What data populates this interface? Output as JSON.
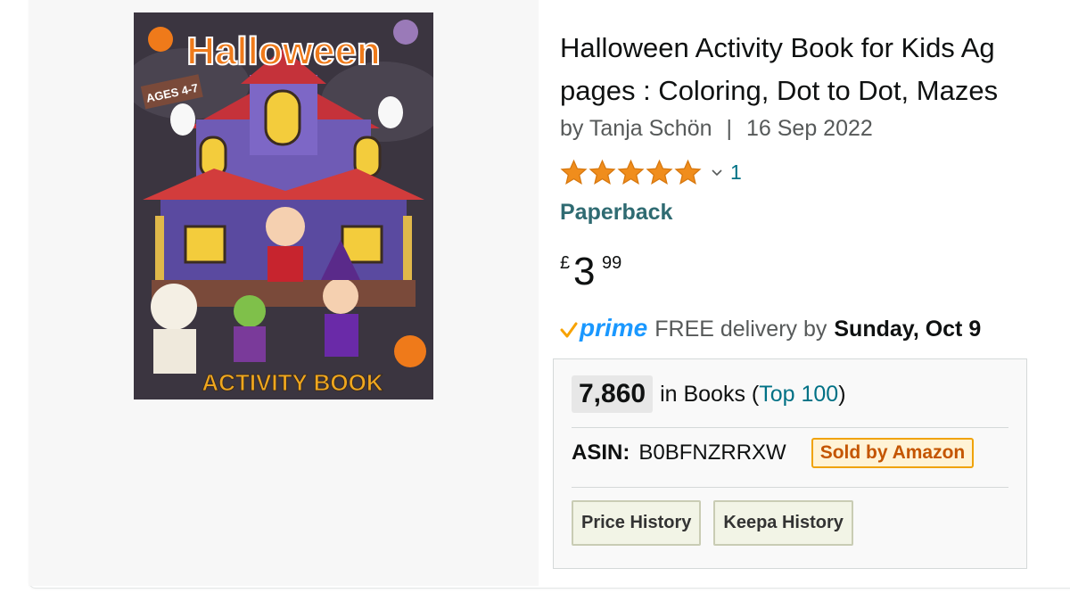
{
  "product": {
    "title_line1": "Halloween Activity Book for Kids Ag",
    "title_line2": "pages : Coloring, Dot to Dot, Mazes",
    "author": "by Tanja Schön",
    "separator": "|",
    "date": "16 Sep 2022",
    "rating_stars": 5,
    "rating_count": "1",
    "format": "Paperback"
  },
  "cover": {
    "title": "Halloween",
    "ages": "AGES 4-7",
    "subtitle": "ACTIVITY BOOK"
  },
  "price": {
    "symbol": "£",
    "whole": "3",
    "fraction": "99"
  },
  "delivery": {
    "prime_label": "prime",
    "text": "FREE delivery by",
    "day": "Sunday, Oct 9"
  },
  "info": {
    "rank": "7,860",
    "rank_prefix_text": "in Books (",
    "rank_link": "Top 100",
    "rank_suffix_text": ")",
    "asin_label": "ASIN:",
    "asin_value": "B0BFNZRRXW",
    "sold_by": "Sold by Amazon",
    "price_history": "Price History",
    "keepa_history": "Keepa History"
  },
  "colors": {
    "star": "#f08d1c",
    "link": "#007185",
    "format_link": "#2f6b72",
    "prime_blue": "#1a98ff",
    "prime_check": "#f7a200",
    "sold_border": "#f0a30a"
  }
}
